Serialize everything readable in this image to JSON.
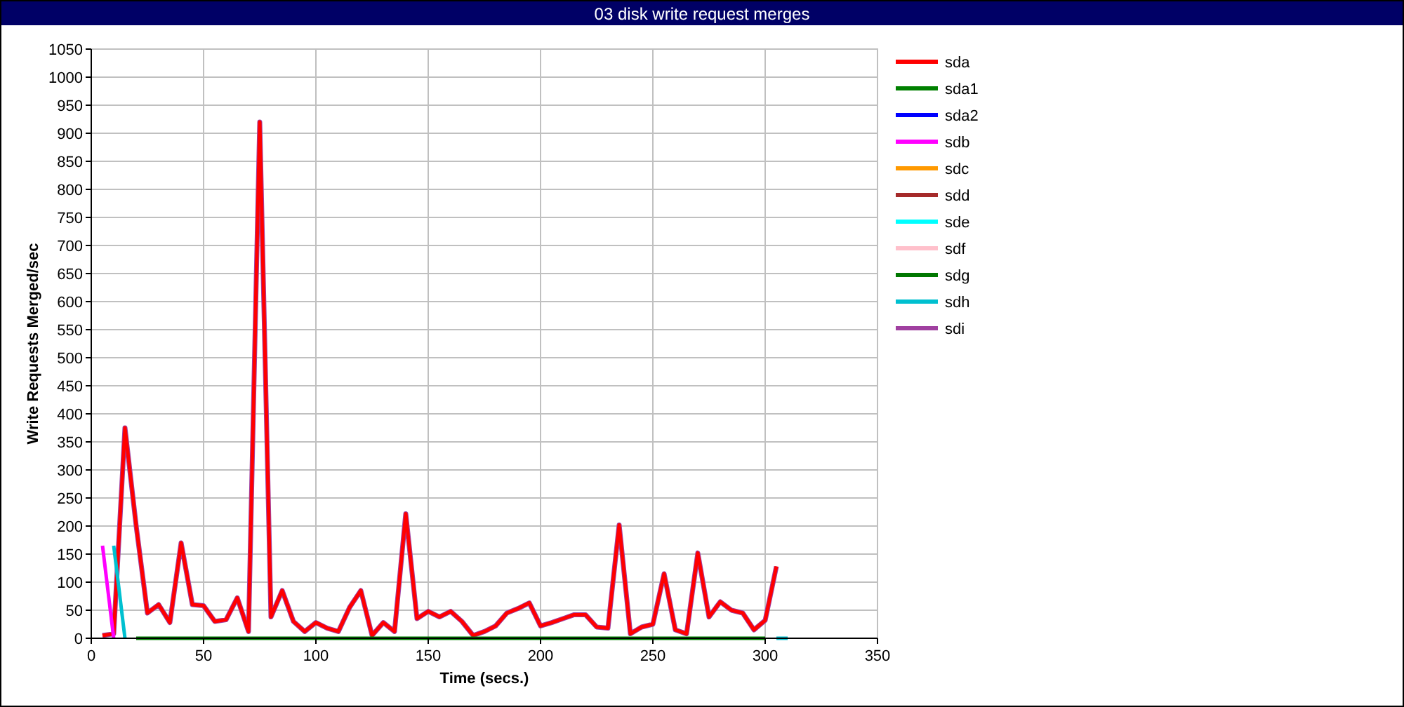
{
  "window": {
    "title": "03 disk write request merges"
  },
  "chart_data": {
    "type": "line",
    "grid": true,
    "legend": true,
    "xlabel": "Time (secs.)",
    "ylabel": "Write Requests Merged/sec",
    "xlim": [
      0,
      350
    ],
    "ylim": [
      0,
      1050
    ],
    "xticks": [
      0,
      50,
      100,
      150,
      200,
      250,
      300,
      350
    ],
    "yticks": [
      0,
      50,
      100,
      150,
      200,
      250,
      300,
      350,
      400,
      450,
      500,
      550,
      600,
      650,
      700,
      750,
      800,
      850,
      900,
      950,
      1000,
      1050
    ],
    "x": [
      5,
      10,
      15,
      20,
      25,
      30,
      35,
      40,
      45,
      50,
      55,
      60,
      65,
      70,
      75,
      80,
      85,
      90,
      95,
      100,
      105,
      110,
      115,
      120,
      125,
      130,
      135,
      140,
      145,
      150,
      155,
      160,
      165,
      170,
      175,
      180,
      185,
      190,
      195,
      200,
      205,
      210,
      215,
      220,
      225,
      230,
      235,
      240,
      245,
      250,
      255,
      260,
      265,
      270,
      275,
      280,
      285,
      290,
      295,
      300,
      305,
      310
    ],
    "series": [
      {
        "name": "sda",
        "color": "#ff0000",
        "values": [
          5,
          8,
          375,
          200,
          45,
          60,
          28,
          170,
          60,
          58,
          30,
          33,
          72,
          12,
          920,
          38,
          85,
          30,
          12,
          28,
          18,
          12,
          55,
          85,
          5,
          28,
          12,
          222,
          35,
          48,
          38,
          48,
          30,
          5,
          12,
          22,
          45,
          53,
          63,
          22,
          28,
          35,
          42,
          42,
          20,
          18,
          202,
          8,
          20,
          25,
          115,
          15,
          8,
          152,
          38,
          65,
          50,
          45,
          15,
          32,
          128,
          null
        ]
      },
      {
        "name": "sda1",
        "color": "#008000",
        "values": [
          null,
          null,
          null,
          0,
          0,
          0,
          0,
          0,
          0,
          0,
          0,
          0,
          0,
          0,
          0,
          0,
          0,
          0,
          0,
          0,
          0,
          0,
          0,
          0,
          0,
          0,
          0,
          0,
          0,
          0,
          0,
          0,
          0,
          0,
          0,
          0,
          0,
          0,
          0,
          0,
          0,
          0,
          0,
          0,
          0,
          0,
          0,
          0,
          0,
          0,
          0,
          0,
          0,
          0,
          0,
          0,
          0,
          0,
          0,
          0,
          null,
          null
        ]
      },
      {
        "name": "sda2",
        "color": "#0000ff",
        "values": [
          null,
          null,
          null,
          null,
          null,
          null,
          null,
          null,
          null,
          null,
          null,
          null,
          null,
          null,
          null,
          null,
          null,
          null,
          null,
          null,
          null,
          null,
          null,
          null,
          null,
          null,
          null,
          null,
          null,
          null,
          null,
          null,
          null,
          null,
          null,
          null,
          null,
          null,
          null,
          null,
          null,
          null,
          null,
          null,
          null,
          null,
          null,
          null,
          null,
          null,
          null,
          null,
          null,
          null,
          null,
          null,
          null,
          null,
          null,
          null,
          null,
          null
        ]
      },
      {
        "name": "sdb",
        "color": "#ff00ff",
        "values": [
          165,
          0,
          null,
          null,
          null,
          null,
          null,
          null,
          null,
          null,
          null,
          null,
          null,
          null,
          null,
          null,
          null,
          null,
          null,
          null,
          null,
          null,
          null,
          null,
          null,
          null,
          null,
          null,
          null,
          null,
          null,
          null,
          null,
          null,
          null,
          null,
          null,
          null,
          null,
          null,
          null,
          null,
          null,
          null,
          null,
          null,
          null,
          null,
          null,
          null,
          null,
          null,
          null,
          null,
          null,
          null,
          null,
          null,
          null,
          null,
          null,
          null
        ]
      },
      {
        "name": "sdc",
        "color": "#ff9900",
        "values": [
          null,
          null,
          null,
          null,
          null,
          null,
          null,
          null,
          null,
          null,
          null,
          null,
          null,
          null,
          null,
          null,
          null,
          null,
          null,
          null,
          null,
          null,
          null,
          null,
          null,
          null,
          null,
          null,
          null,
          null,
          null,
          null,
          null,
          null,
          null,
          null,
          null,
          null,
          null,
          null,
          null,
          null,
          null,
          null,
          null,
          null,
          null,
          null,
          null,
          null,
          null,
          null,
          null,
          null,
          null,
          null,
          null,
          null,
          null,
          null,
          null,
          null
        ]
      },
      {
        "name": "sdd",
        "color": "#a52a2a",
        "values": [
          null,
          null,
          null,
          null,
          null,
          null,
          null,
          null,
          null,
          null,
          null,
          null,
          null,
          null,
          null,
          null,
          null,
          null,
          null,
          null,
          null,
          null,
          null,
          null,
          null,
          null,
          null,
          null,
          null,
          null,
          null,
          null,
          null,
          null,
          null,
          null,
          null,
          null,
          null,
          null,
          null,
          null,
          null,
          null,
          null,
          null,
          null,
          null,
          null,
          null,
          null,
          null,
          null,
          null,
          null,
          null,
          null,
          null,
          null,
          null,
          null,
          null
        ]
      },
      {
        "name": "sde",
        "color": "#00ffff",
        "values": [
          null,
          null,
          null,
          null,
          null,
          null,
          null,
          null,
          null,
          null,
          null,
          null,
          null,
          null,
          null,
          null,
          null,
          null,
          null,
          null,
          null,
          null,
          null,
          null,
          null,
          null,
          null,
          null,
          null,
          null,
          null,
          null,
          null,
          null,
          null,
          null,
          null,
          null,
          null,
          null,
          null,
          null,
          null,
          null,
          null,
          null,
          null,
          null,
          null,
          null,
          null,
          null,
          null,
          null,
          null,
          null,
          null,
          null,
          null,
          null,
          null,
          null
        ]
      },
      {
        "name": "sdf",
        "color": "#ffc0cb",
        "values": [
          null,
          null,
          null,
          null,
          null,
          null,
          null,
          null,
          null,
          null,
          null,
          null,
          null,
          null,
          null,
          null,
          null,
          null,
          null,
          null,
          null,
          null,
          null,
          null,
          null,
          null,
          null,
          null,
          null,
          null,
          null,
          null,
          null,
          null,
          null,
          null,
          null,
          null,
          null,
          null,
          null,
          null,
          null,
          null,
          null,
          null,
          null,
          null,
          null,
          null,
          null,
          null,
          null,
          null,
          null,
          null,
          null,
          null,
          null,
          null,
          null,
          null
        ]
      },
      {
        "name": "sdg",
        "color": "#007700",
        "values": [
          null,
          null,
          null,
          null,
          null,
          null,
          null,
          null,
          null,
          null,
          null,
          null,
          null,
          null,
          null,
          null,
          null,
          null,
          null,
          null,
          null,
          null,
          null,
          null,
          null,
          null,
          null,
          null,
          null,
          null,
          null,
          null,
          null,
          null,
          null,
          null,
          null,
          null,
          null,
          null,
          null,
          null,
          null,
          null,
          null,
          null,
          null,
          null,
          null,
          null,
          null,
          null,
          null,
          null,
          null,
          null,
          null,
          null,
          null,
          null,
          null,
          null
        ]
      },
      {
        "name": "sdh",
        "color": "#00c0d0",
        "values": [
          null,
          165,
          0,
          null,
          null,
          null,
          null,
          null,
          null,
          null,
          null,
          null,
          null,
          null,
          null,
          null,
          null,
          null,
          null,
          null,
          null,
          null,
          null,
          null,
          null,
          null,
          null,
          null,
          null,
          null,
          null,
          null,
          null,
          null,
          null,
          null,
          null,
          null,
          null,
          null,
          null,
          null,
          null,
          null,
          null,
          null,
          null,
          null,
          null,
          null,
          null,
          null,
          null,
          null,
          null,
          null,
          null,
          null,
          null,
          null,
          0,
          0
        ]
      },
      {
        "name": "sdi",
        "color": "#a040a0",
        "values": [
          5,
          8,
          375,
          200,
          45,
          60,
          28,
          170,
          60,
          58,
          30,
          33,
          72,
          12,
          920,
          38,
          85,
          30,
          12,
          28,
          18,
          12,
          55,
          85,
          5,
          28,
          12,
          222,
          35,
          48,
          38,
          48,
          30,
          5,
          12,
          22,
          45,
          53,
          63,
          22,
          28,
          35,
          42,
          42,
          20,
          18,
          202,
          8,
          20,
          25,
          115,
          15,
          8,
          152,
          38,
          65,
          50,
          45,
          15,
          32,
          128,
          null
        ]
      }
    ]
  }
}
